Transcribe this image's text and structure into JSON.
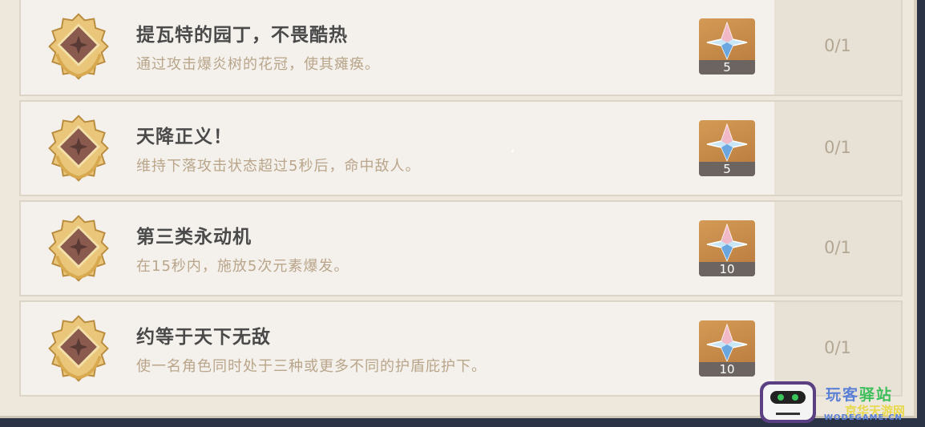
{
  "achievements": [
    {
      "title": "提瓦特的园丁，不畏酷热",
      "description": "通过攻击爆炎树的花冠，使其瘫痪。",
      "reward_count": "5",
      "progress": "0/1"
    },
    {
      "title": "天降正义！",
      "description": "维持下落攻击状态超过5秒后，命中敌人。",
      "reward_count": "5",
      "progress": "0/1"
    },
    {
      "title": "第三类永动机",
      "description": "在15秒内，施放5次元素爆发。",
      "reward_count": "10",
      "progress": "0/1"
    },
    {
      "title": "约等于天下无敌",
      "description": "使一名角色同时处于三种或更多不同的护盾庇护下。",
      "reward_count": "10",
      "progress": "0/1"
    }
  ],
  "icons": {
    "badge": "gold-laurel-badge-icon",
    "reward": "primogem-icon"
  },
  "colors": {
    "panel": "#ede7dc",
    "row": "#f4f1ec",
    "title": "#4a4a4a",
    "description": "#b9a58a",
    "reward_bg": "#c98a48"
  },
  "watermark": {
    "line1_a": "玩客",
    "line1_b": "驿站",
    "line2": "京华天游网",
    "line3": "WODEGAME.CN"
  }
}
